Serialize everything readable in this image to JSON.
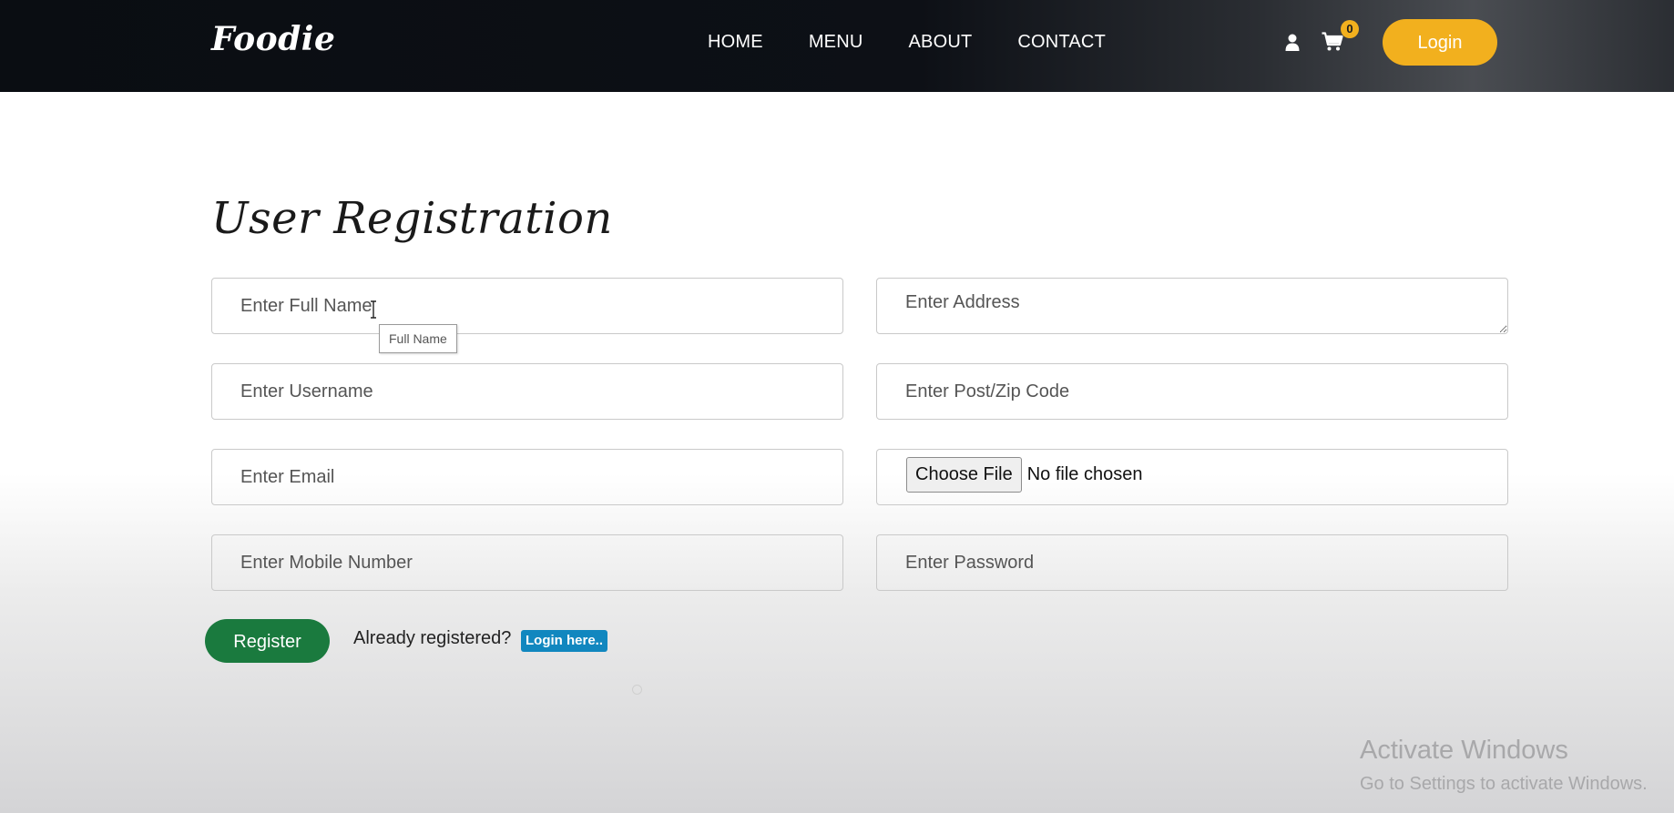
{
  "header": {
    "logo": "Foodie",
    "nav": [
      "HOME",
      "MENU",
      "ABOUT",
      "CONTACT"
    ],
    "icons": {
      "user": "user-icon",
      "cart": "cart-icon"
    },
    "cart_count": "0",
    "login_label": "Login"
  },
  "form": {
    "title": "User Registration",
    "full_name_placeholder": "Enter Full Name",
    "full_name_tooltip": "Full Name",
    "username_placeholder": "Enter Username",
    "email_placeholder": "Enter Email",
    "mobile_placeholder": "Enter Mobile Number",
    "address_placeholder": "Enter Address",
    "postcode_placeholder": "Enter Post/Zip Code",
    "file_button": "Choose File",
    "file_status": "No file chosen",
    "password_placeholder": "Enter Password",
    "register_label": "Register",
    "already_text": "Already registered?",
    "login_here": "Login here.."
  },
  "watermark": {
    "title": "Activate Windows",
    "subtitle": "Go to Settings to activate Windows."
  },
  "colors": {
    "accent": "#f2b01e",
    "register": "#1a7a3e",
    "link_badge": "#1187bf",
    "header_bg": "#0d1016"
  }
}
